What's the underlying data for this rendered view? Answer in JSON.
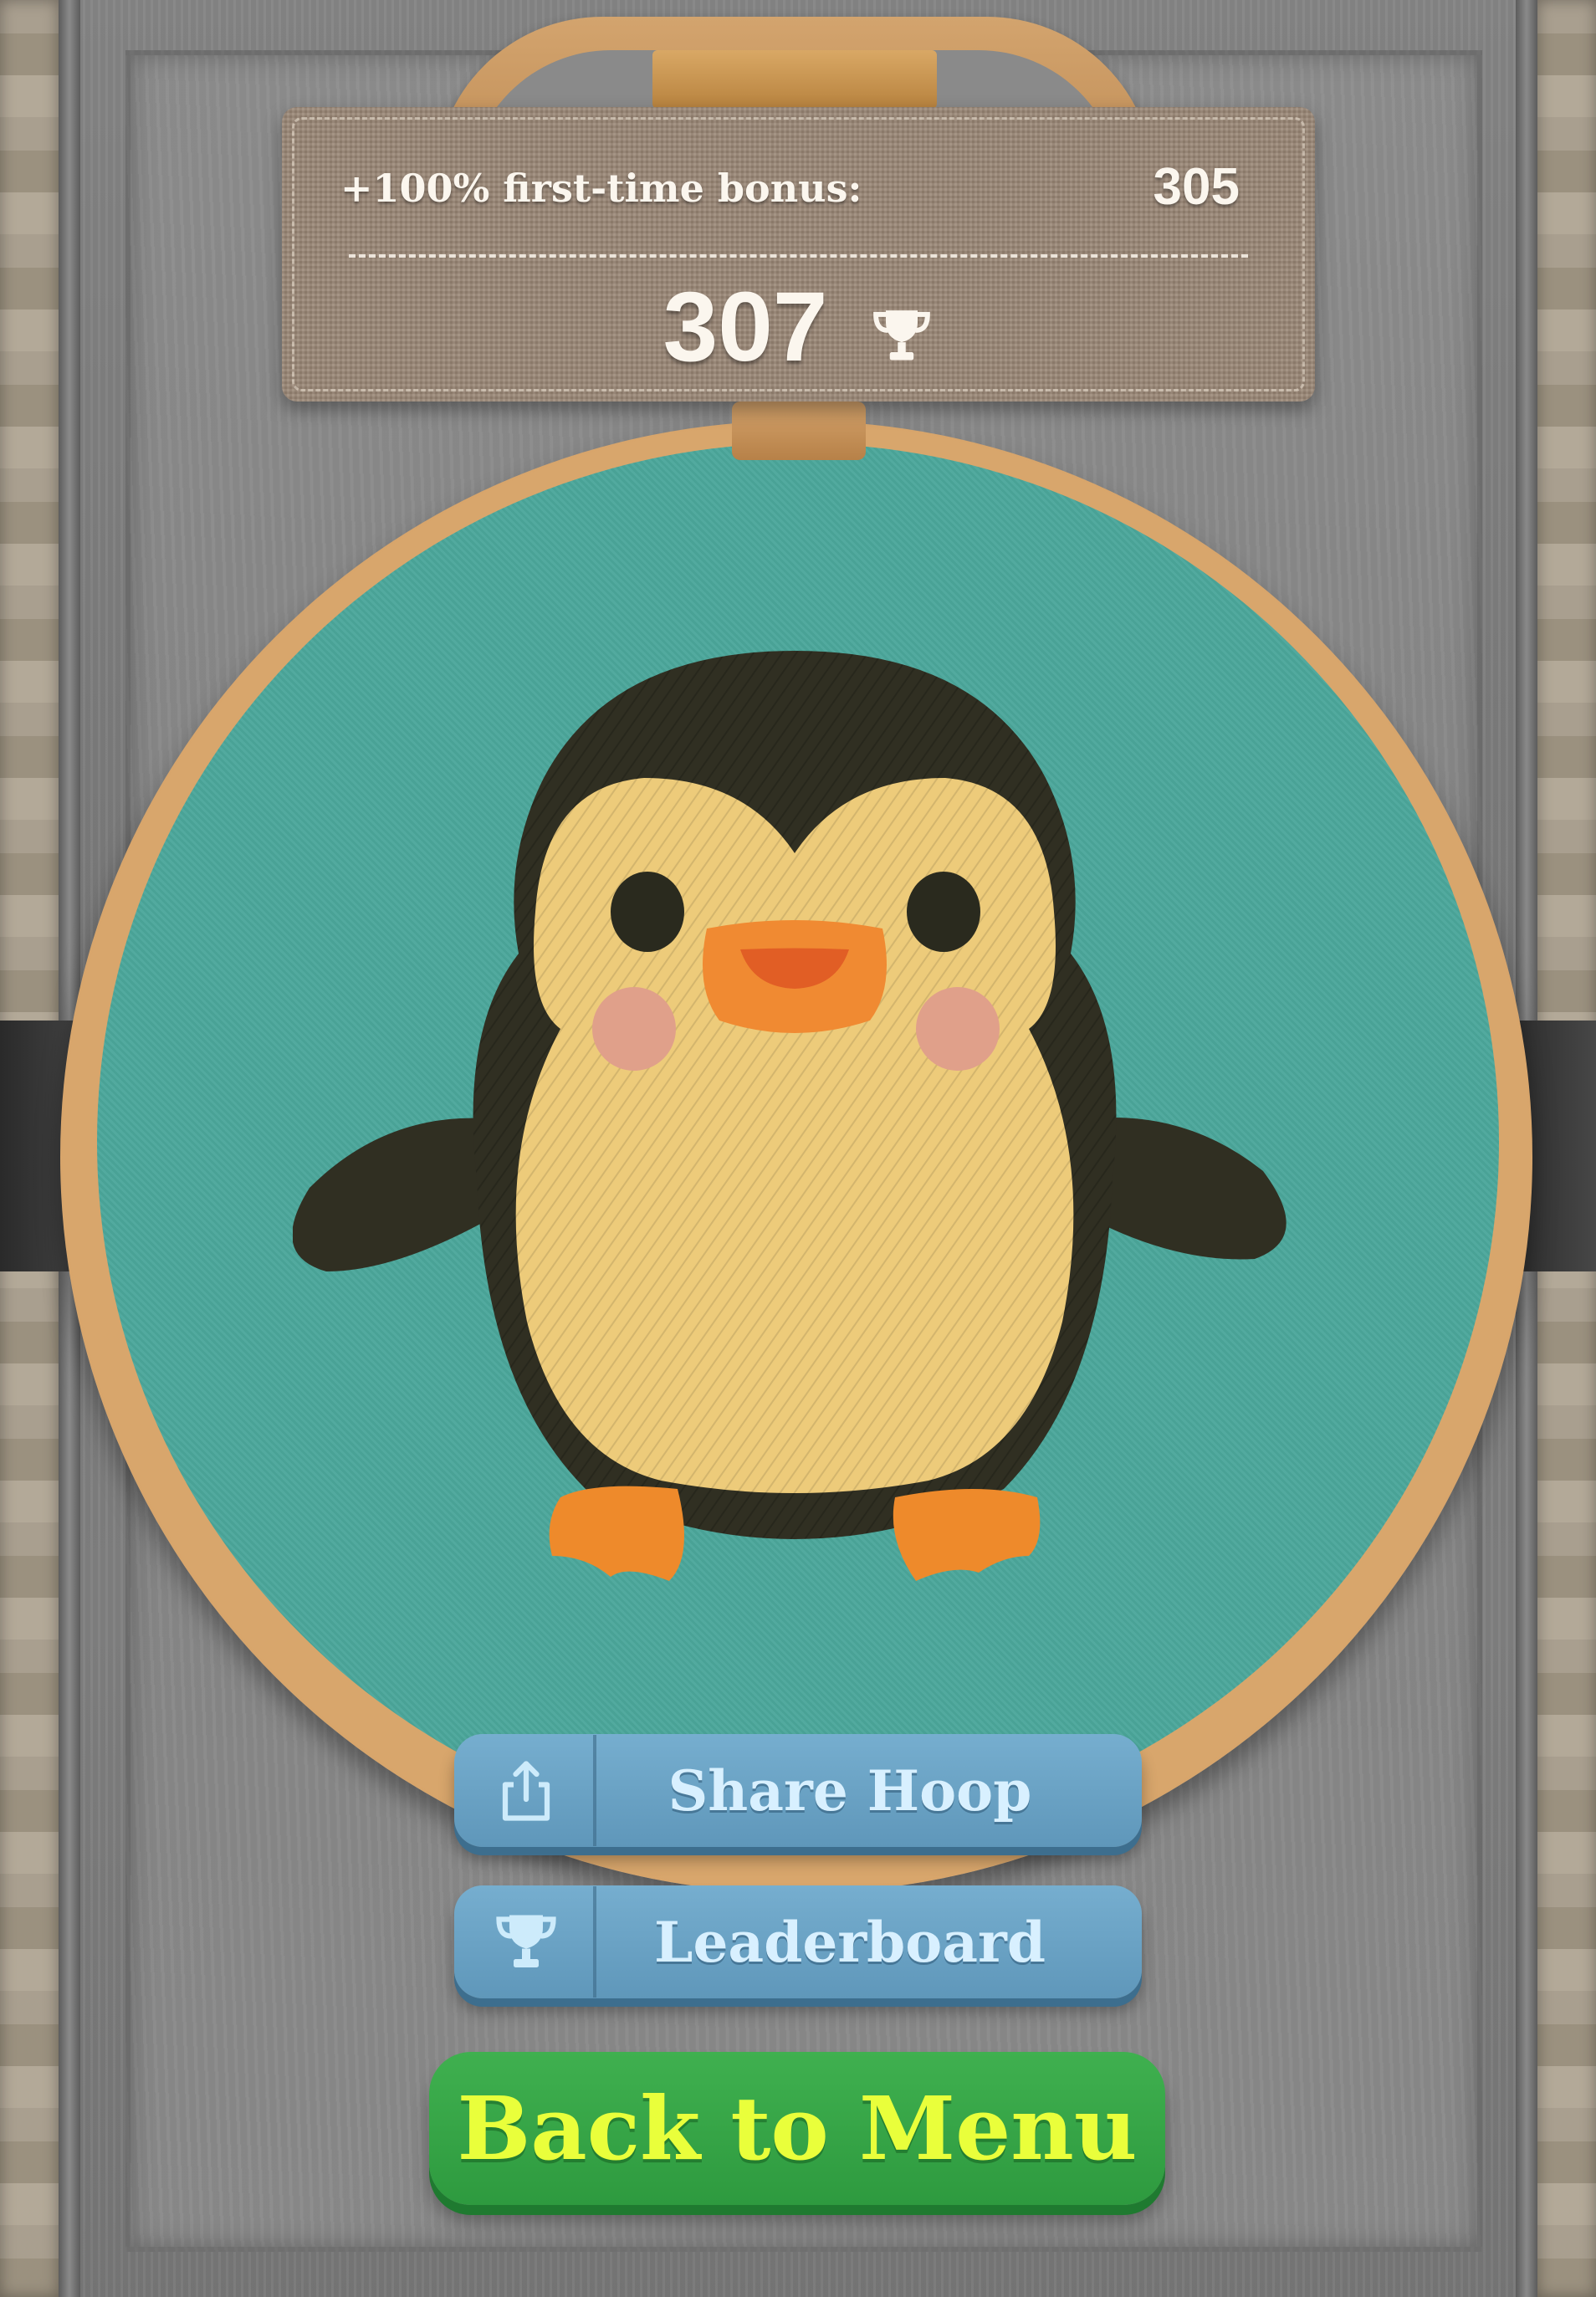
{
  "score": {
    "bonus_label": "+100% first-time bonus:",
    "bonus_value": "305",
    "total": "307"
  },
  "buttons": {
    "share_label": "Share Hoop",
    "leaderboard_label": "Leaderboard",
    "back_label": "Back to Menu"
  },
  "icons": {
    "share": "share-icon",
    "trophy": "trophy-icon"
  },
  "colors": {
    "fabric": "#4ba79b",
    "hoop_wood": "#d8a66c",
    "button_blue": "#6aa2c5",
    "button_blue_text": "#d8f0ff",
    "button_green": "#36a447",
    "button_green_text": "#e9ff3b"
  }
}
